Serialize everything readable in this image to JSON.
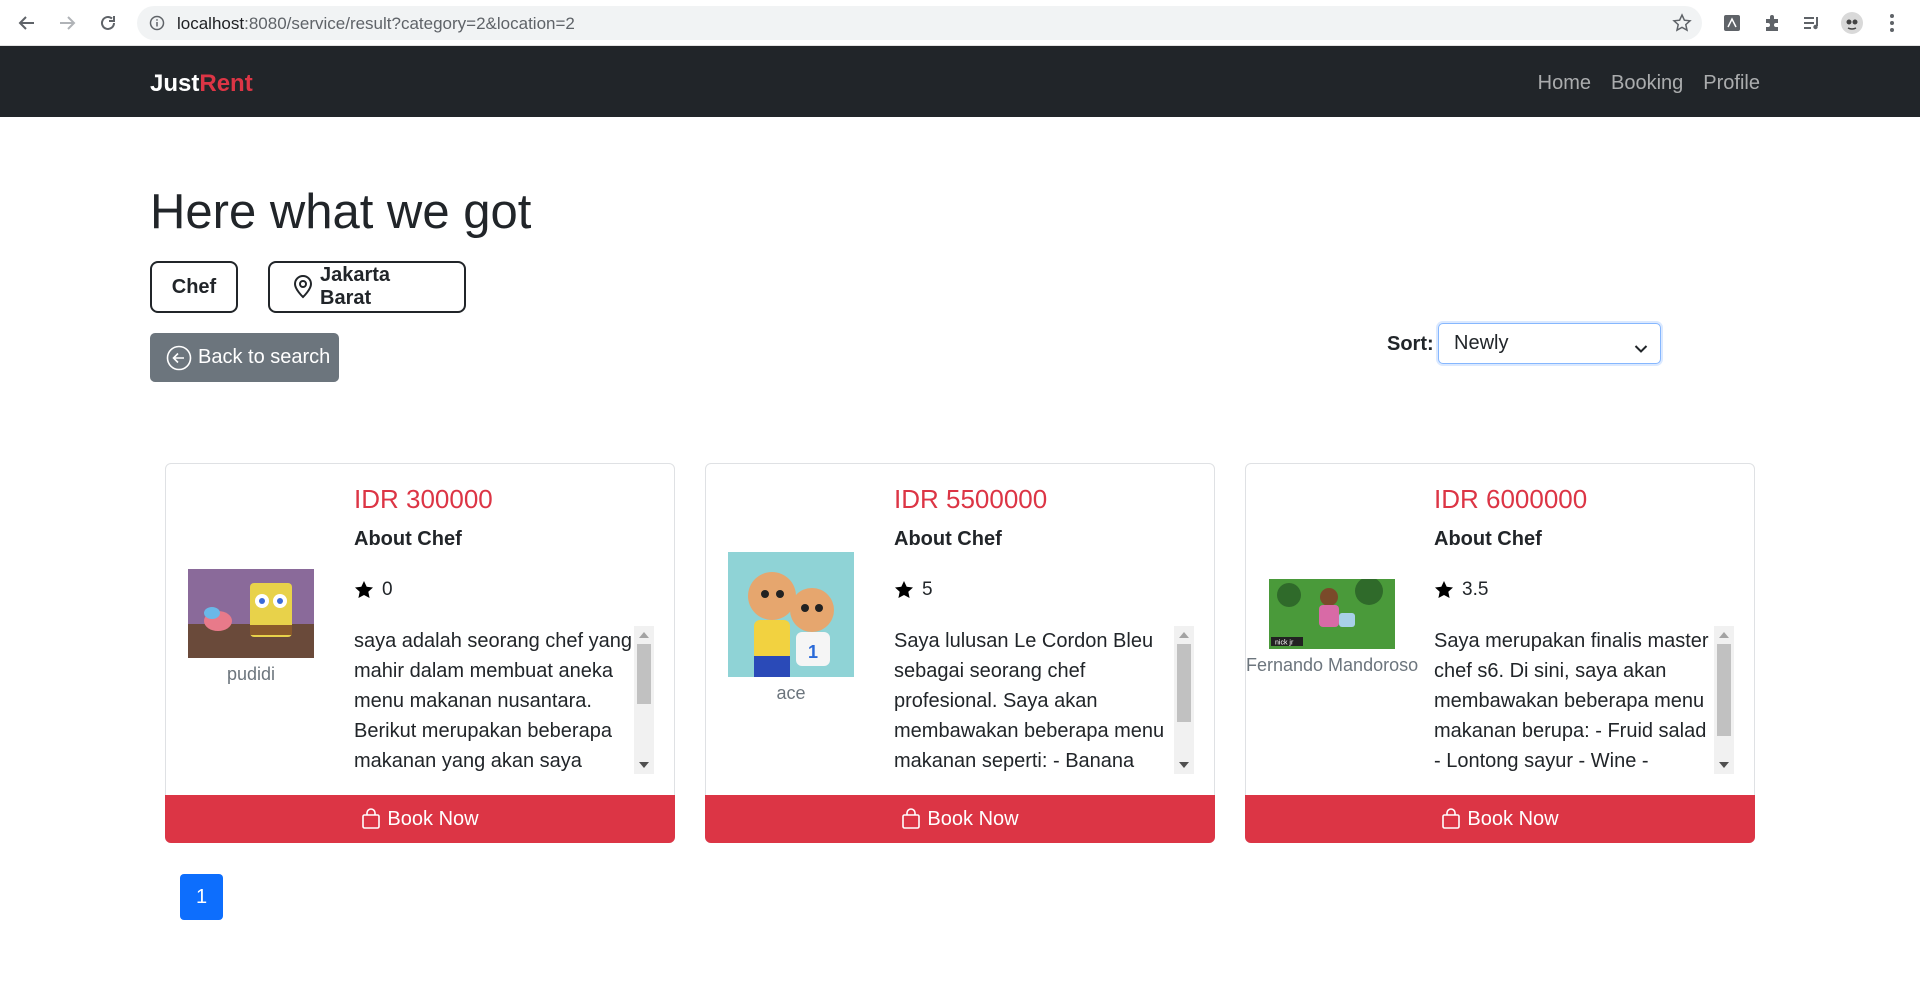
{
  "browser": {
    "url_host": "localhost",
    "url_rest": ":8080/service/result?category=2&location=2"
  },
  "navbar": {
    "brand_part1": "Just",
    "brand_part2": "Rent",
    "links": [
      "Home",
      "Booking",
      "Profile"
    ]
  },
  "page": {
    "title": "Here what we got",
    "filter_category": "Chef",
    "filter_location": "Jakarta Barat",
    "back_label": "Back to search",
    "sort_label": "Sort:",
    "sort_value": "Newly"
  },
  "cards": [
    {
      "name": "pudidi",
      "price": "IDR 300000",
      "about": "About Chef",
      "rating": "0",
      "description": "saya adalah seorang chef yang mahir dalam membuat aneka menu makanan nusantara. Berikut merupakan beberapa makanan yang akan saya",
      "book_label": "Book Now",
      "scroll_position": 0.0,
      "avatar_colors": [
        "#8a6a9a",
        "#d8b84a",
        "#6a4a3a"
      ]
    },
    {
      "name": "ace",
      "price": "IDR 5500000",
      "about": "About Chef",
      "rating": "5",
      "description": "Saya lulusan Le Cordon Bleu sebagai seorang chef profesional. Saya akan membawakan beberapa menu makanan seperti: - Banana",
      "book_label": "Book Now",
      "scroll_position": 0.0,
      "avatar_colors": [
        "#8fd3d6",
        "#e6a66e",
        "#f2d240"
      ]
    },
    {
      "name": "Fernando Mandoroso",
      "price": "IDR 6000000",
      "about": "About Chef",
      "rating": "3.5",
      "description": "Saya merupakan finalis master chef s6. Di sini, saya akan membawakan beberapa menu makanan berupa: - Fruid salad - Lontong sayur - Wine -",
      "book_label": "Book Now",
      "scroll_position": 0.0,
      "avatar_colors": [
        "#4a9a3a",
        "#d86aa6",
        "#2f6a2a"
      ]
    }
  ],
  "pagination": {
    "current": "1"
  }
}
